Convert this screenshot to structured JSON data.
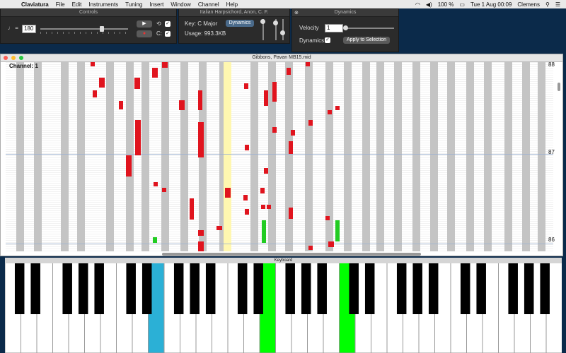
{
  "menubar": {
    "app_name": "Claviatura",
    "items": [
      "File",
      "Edit",
      "Instruments",
      "Tuning",
      "Insert",
      "Window",
      "Channel",
      "Help"
    ],
    "battery": "100 %",
    "datetime": "Tue 1 Aug  00:09",
    "user": "Clemens"
  },
  "controls": {
    "title": "Controls",
    "tempo_symbol": "♩ =",
    "tempo": "180",
    "c_label": "C:"
  },
  "info": {
    "title": "Italian Harpsichord, Anon, C. F.",
    "key": "Key: C Major",
    "usage": "Usage: 993.3KB",
    "dynamics_button": "Dynamics"
  },
  "dynamics": {
    "title": "Dynamics",
    "velocity_label": "Velocity",
    "velocity_value": "1",
    "dynamics_label": "Dynamics",
    "apply_button": "Apply to Selection"
  },
  "window": {
    "title": "Gibbons, Pavan MB15.mid",
    "channel": "Channel: 1",
    "notes": [
      "88",
      "87",
      "86"
    ]
  },
  "keyboard": {
    "title": "Keyboard"
  },
  "colors": {
    "accent_blue": "#2bb0d6",
    "accent_green": "#00ff00",
    "note_red": "#e0141e",
    "highlight_yellow": "#fff7b0"
  }
}
